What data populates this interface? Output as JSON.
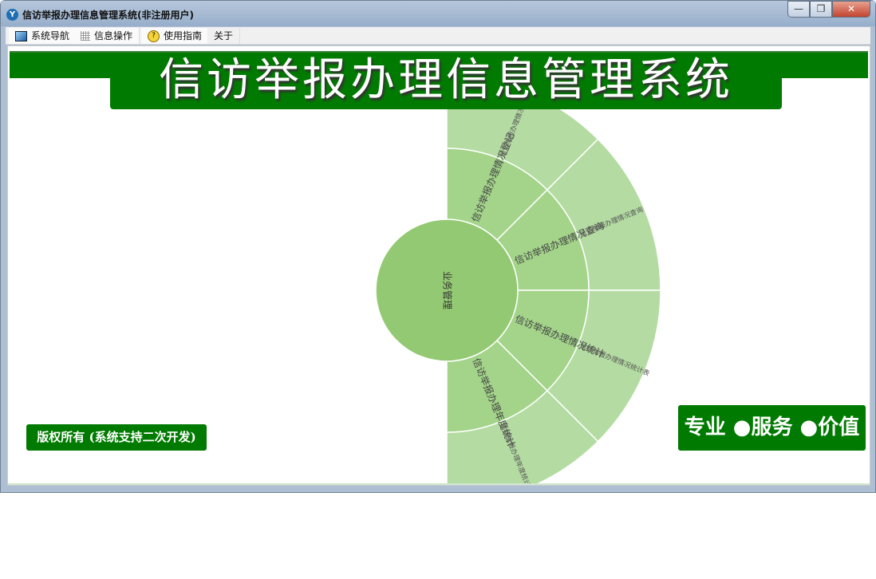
{
  "window": {
    "title": "信访举报办理信息管理系统(非注册用户)",
    "controls": {
      "minimize": "—",
      "restore": "❐",
      "close": "✕"
    }
  },
  "menu": [
    {
      "label": "系统导航",
      "icon": "monitor-icon"
    },
    {
      "label": "信息操作",
      "icon": "grid-icon"
    },
    {
      "label": "使用指南",
      "icon": "help-icon"
    },
    {
      "label": "关于",
      "icon": ""
    }
  ],
  "banner": {
    "title": "信访举报办理信息管理系统"
  },
  "footer": {
    "copyright": "版权所有 (系统支持二次开发)",
    "slogan": "专业 ●服务 ●价值"
  },
  "colors": {
    "brand": "#007a00",
    "center": "#93c972",
    "ring1": "#a3d48a",
    "ring2": "#b4dca2"
  },
  "sunburst": {
    "center": "业务管理",
    "children": [
      {
        "label": "信访举报办理情况登记",
        "child": "信访举报办理情况登记"
      },
      {
        "label": "信访举报办理情况查询",
        "child": "信访举报办理情况查询"
      },
      {
        "label": "信访举报办理情况统计",
        "child": "信访举报办理情况统计表"
      },
      {
        "label": "信访举报办理年度统计",
        "child": "信访举报办理年度统计"
      }
    ]
  }
}
